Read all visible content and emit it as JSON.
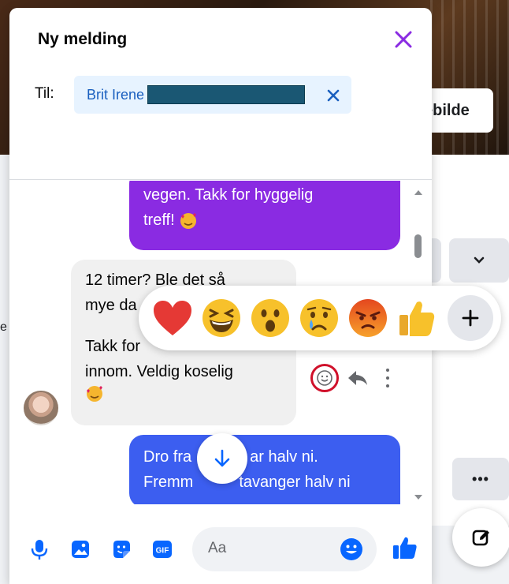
{
  "background": {
    "cover_button_label": "ebilde",
    "edge_letter": "e",
    "more_label": "•••"
  },
  "chat": {
    "title": "Ny melding",
    "to_label": "Til:",
    "recipient_name": "Brit Irene"
  },
  "messages": [
    {
      "from": "me",
      "color": "#8a2be2",
      "lines": [
        "vegen. Takk for hyggelig",
        "treff!"
      ],
      "emoji": "smiling-face-with-hearts"
    },
    {
      "from": "them",
      "lines": [
        "12 timer? Ble det så",
        "mye da"
      ]
    },
    {
      "from": "them",
      "lines": [
        "Takk for",
        "innom. Veldig koselig"
      ],
      "emoji": "smiling-face-with-hearts"
    },
    {
      "from": "me",
      "color": "#3c5ef0",
      "lines": [
        "Dro fra",
        "ar halv ni.",
        "Fremm",
        "tavanger halv ni"
      ]
    }
  ],
  "reactions": [
    "heart",
    "laughing-face",
    "surprised-face",
    "crying-face",
    "angry-face",
    "thumbs-up"
  ],
  "composer": {
    "placeholder": "Aa"
  },
  "colors": {
    "accent": "#8a2be2",
    "messenger_blue": "#0866ff",
    "reaction_highlight": "#d0112b"
  }
}
